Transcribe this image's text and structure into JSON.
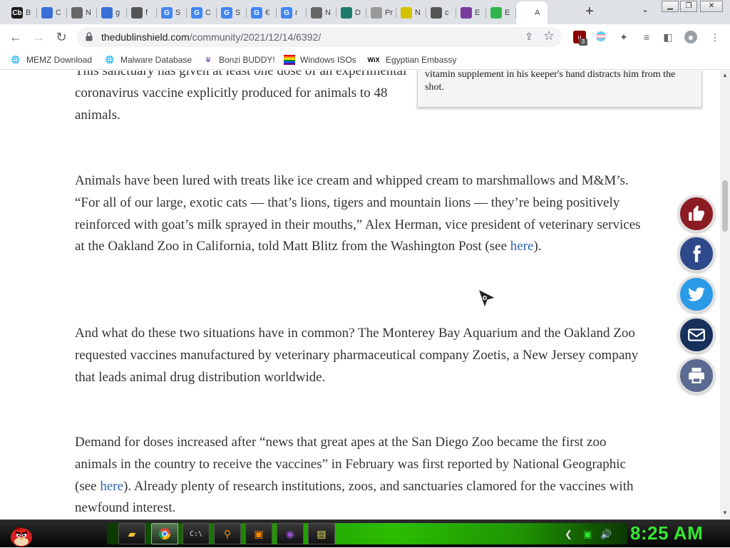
{
  "browser": {
    "tabs": [
      {
        "label": "B",
        "icon": "Cb",
        "color": "#1b1b1b"
      },
      {
        "label": "C",
        "icon": "",
        "color": "#3a6fd8"
      },
      {
        "label": "N",
        "icon": "",
        "color": "#666666"
      },
      {
        "label": "g",
        "icon": "",
        "color": "#3a6fd8"
      },
      {
        "label": "f",
        "icon": "",
        "color": "#555555"
      },
      {
        "label": "S",
        "icon": "G",
        "color": "#4285f4"
      },
      {
        "label": "C",
        "icon": "G",
        "color": "#4285f4"
      },
      {
        "label": "S",
        "icon": "G",
        "color": "#4285f4"
      },
      {
        "label": "€",
        "icon": "G",
        "color": "#4285f4"
      },
      {
        "label": "r",
        "icon": "G",
        "color": "#4285f4"
      },
      {
        "label": "N",
        "icon": "",
        "color": "#666666"
      },
      {
        "label": "D",
        "icon": "",
        "color": "#1e7b6a"
      },
      {
        "label": "Pr",
        "icon": "",
        "color": "#999999"
      },
      {
        "label": "N",
        "icon": "",
        "color": "#d4c200"
      },
      {
        "label": "c",
        "icon": "",
        "color": "#555555"
      },
      {
        "label": "E",
        "icon": "",
        "color": "#7a3a9a"
      },
      {
        "label": "E",
        "icon": "",
        "color": "#2fb54a"
      },
      {
        "label": "A",
        "icon": "",
        "color": "#ffffff"
      }
    ],
    "new_tab_label": "+",
    "url_domain": "thedublinshield.com",
    "url_path": "/community/2021/12/14/6392/",
    "extension_badge": "3"
  },
  "bookmarks": [
    {
      "label": "MEMZ Download",
      "icon": "globe-icon"
    },
    {
      "label": "Malware Database",
      "icon": "globe-icon"
    },
    {
      "label": "Bonzi BUDDY!",
      "icon": "bonzi-icon"
    },
    {
      "label": "Windows ISOs",
      "icon": "windows-flag-icon"
    },
    {
      "label": "Egyptian Embassy",
      "icon": "wix-icon"
    }
  ],
  "article": {
    "caption_text": "vitamin supplement in his keeper's hand distracts him from the shot.",
    "p1": "This sanctuary has given at least one dose of an experimental coronavirus vaccine explicitly produced for animals to 48 animals.",
    "p2_before": "Animals have been lured with treats like ice cream and whipped cream to marshmallows and M&M’s. “For all of our large, exotic cats — that’s lions, tigers and mountain lions — they’re being positively reinforced with goat’s milk sprayed in their mouths,” Alex Herman, vice president of veterinary services at the Oakland Zoo in California, told Matt Blitz from the Washington Post (see ",
    "p2_link": "here",
    "p2_after": ").",
    "p3": "And what do these two situations have in common? The Monterey Bay Aquarium and the Oakland Zoo requested vaccines manufactured by veterinary pharmaceutical company Zoetis, a New Jersey company that leads animal drug distribution worldwide.",
    "p4_before": "Demand for doses increased after “news that great apes at the San Diego Zoo became the first zoo animals in the country to receive the vaccines” in February was first reported by National Geographic (see ",
    "p4_link": "here",
    "p4_after": "). Already plenty of research institutions, zoos, and sanctuaries clamored for the vaccines with newfound interest."
  },
  "share_buttons": [
    {
      "name": "like",
      "color": "#8b1c24"
    },
    {
      "name": "facebook",
      "color": "#2f4a8a"
    },
    {
      "name": "twitter",
      "color": "#2b9be8"
    },
    {
      "name": "email",
      "color": "#17305c"
    },
    {
      "name": "print",
      "color": "#5a6a90"
    }
  ],
  "taskbar": {
    "clock": "8:25 AM",
    "accent": "#33e833"
  }
}
